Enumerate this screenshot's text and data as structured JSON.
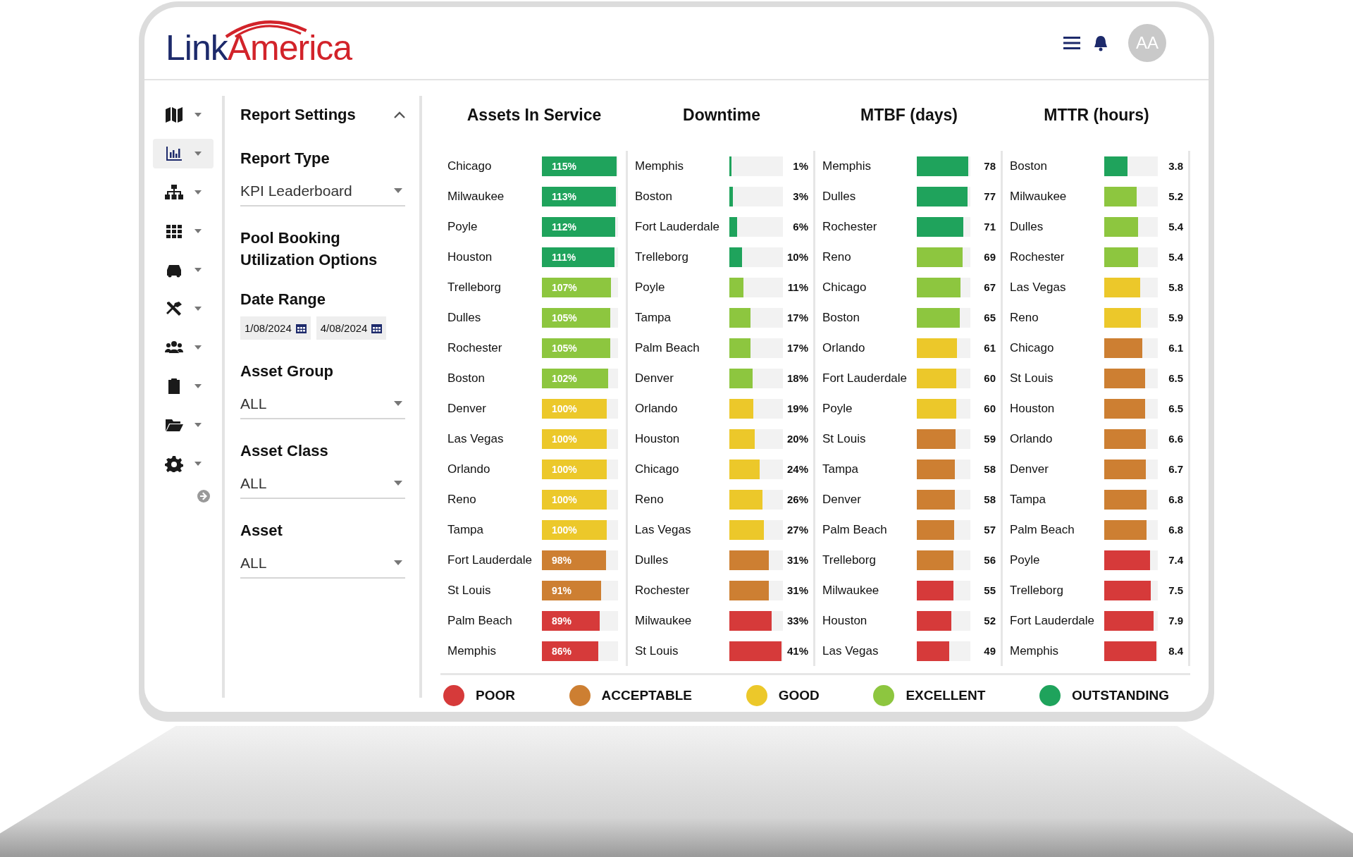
{
  "header": {
    "logo": {
      "part_1": "Link",
      "part_2": "America"
    },
    "avatar": "AA"
  },
  "sidebar": {
    "items": [
      {
        "selected": false
      },
      {
        "selected": true
      },
      {
        "selected": false
      },
      {
        "selected": false
      },
      {
        "selected": false
      },
      {
        "selected": false
      },
      {
        "selected": false
      },
      {
        "selected": false
      },
      {
        "selected": false
      },
      {
        "selected": false
      }
    ]
  },
  "settings": {
    "title": "Report Settings",
    "expanded": true,
    "fields": [
      {
        "kind": "select",
        "label": "Report Type",
        "value": "KPI Leaderboard"
      },
      {
        "kind": "heading",
        "label": "Pool Booking Utilization Options"
      },
      {
        "kind": "date_range",
        "label": "Date Range",
        "values": [
          "1/08/2024",
          "4/08/2024"
        ]
      },
      {
        "kind": "select",
        "label": "Asset Group",
        "value": "ALL"
      },
      {
        "kind": "select",
        "label": "Asset Class",
        "value": "ALL"
      },
      {
        "kind": "select",
        "label": "Asset",
        "value": "ALL"
      }
    ]
  },
  "metrics": [
    {
      "title": "Assets In Service",
      "kind": "inbar",
      "rows": [
        {
          "name": "Chicago",
          "value": "115%",
          "level": 0.98,
          "color": "#1fa35c"
        },
        {
          "name": "Milwaukee",
          "value": "113%",
          "level": 0.97,
          "color": "#1fa35c"
        },
        {
          "name": "Poyle",
          "value": "112%",
          "level": 0.96,
          "color": "#1fa35c"
        },
        {
          "name": "Houston",
          "value": "111%",
          "level": 0.95,
          "color": "#1fa35c"
        },
        {
          "name": "Trelleborg",
          "value": "107%",
          "level": 0.91,
          "color": "#8dc63f"
        },
        {
          "name": "Dulles",
          "value": "105%",
          "level": 0.9,
          "color": "#8dc63f"
        },
        {
          "name": "Rochester",
          "value": "105%",
          "level": 0.9,
          "color": "#8dc63f"
        },
        {
          "name": "Boston",
          "value": "102%",
          "level": 0.87,
          "color": "#8dc63f"
        },
        {
          "name": "Denver",
          "value": "100%",
          "level": 0.85,
          "color": "#ecc82a"
        },
        {
          "name": "Las Vegas",
          "value": "100%",
          "level": 0.85,
          "color": "#ecc82a"
        },
        {
          "name": "Orlando",
          "value": "100%",
          "level": 0.85,
          "color": "#ecc82a"
        },
        {
          "name": "Reno",
          "value": "100%",
          "level": 0.85,
          "color": "#ecc82a"
        },
        {
          "name": "Tampa",
          "value": "100%",
          "level": 0.85,
          "color": "#ecc82a"
        },
        {
          "name": "Fort Lauderdale",
          "value": "98%",
          "level": 0.84,
          "color": "#cd7f32"
        },
        {
          "name": "St Louis",
          "value": "91%",
          "level": 0.78,
          "color": "#cd7f32"
        },
        {
          "name": "Palm Beach",
          "value": "89%",
          "level": 0.76,
          "color": "#d63a3a"
        },
        {
          "name": "Memphis",
          "value": "86%",
          "level": 0.74,
          "color": "#d63a3a"
        }
      ]
    },
    {
      "title": "Downtime",
      "kind": "outbar",
      "rows": [
        {
          "name": "Memphis",
          "value": "1%",
          "level": 0.04,
          "color": "#1fa35c"
        },
        {
          "name": "Boston",
          "value": "3%",
          "level": 0.07,
          "color": "#1fa35c"
        },
        {
          "name": "Fort Lauderdale",
          "value": "6%",
          "level": 0.14,
          "color": "#1fa35c"
        },
        {
          "name": "Trelleborg",
          "value": "10%",
          "level": 0.24,
          "color": "#1fa35c"
        },
        {
          "name": "Poyle",
          "value": "11%",
          "level": 0.26,
          "color": "#8dc63f"
        },
        {
          "name": "Tampa",
          "value": "17%",
          "level": 0.4,
          "color": "#8dc63f"
        },
        {
          "name": "Palm Beach",
          "value": "17%",
          "level": 0.4,
          "color": "#8dc63f"
        },
        {
          "name": "Denver",
          "value": "18%",
          "level": 0.43,
          "color": "#8dc63f"
        },
        {
          "name": "Orlando",
          "value": "19%",
          "level": 0.45,
          "color": "#ecc82a"
        },
        {
          "name": "Houston",
          "value": "20%",
          "level": 0.48,
          "color": "#ecc82a"
        },
        {
          "name": "Chicago",
          "value": "24%",
          "level": 0.57,
          "color": "#ecc82a"
        },
        {
          "name": "Reno",
          "value": "26%",
          "level": 0.62,
          "color": "#ecc82a"
        },
        {
          "name": "Las Vegas",
          "value": "27%",
          "level": 0.64,
          "color": "#ecc82a"
        },
        {
          "name": "Dulles",
          "value": "31%",
          "level": 0.74,
          "color": "#cd7f32"
        },
        {
          "name": "Rochester",
          "value": "31%",
          "level": 0.74,
          "color": "#cd7f32"
        },
        {
          "name": "Milwaukee",
          "value": "33%",
          "level": 0.79,
          "color": "#d63a3a"
        },
        {
          "name": "St Louis",
          "value": "41%",
          "level": 0.98,
          "color": "#d63a3a"
        }
      ]
    },
    {
      "title": "MTBF (days)",
      "kind": "outbar",
      "rows": [
        {
          "name": "Memphis",
          "value": "78",
          "level": 0.96,
          "color": "#1fa35c"
        },
        {
          "name": "Dulles",
          "value": "77",
          "level": 0.95,
          "color": "#1fa35c"
        },
        {
          "name": "Rochester",
          "value": "71",
          "level": 0.87,
          "color": "#1fa35c"
        },
        {
          "name": "Reno",
          "value": "69",
          "level": 0.85,
          "color": "#8dc63f"
        },
        {
          "name": "Chicago",
          "value": "67",
          "level": 0.82,
          "color": "#8dc63f"
        },
        {
          "name": "Boston",
          "value": "65",
          "level": 0.8,
          "color": "#8dc63f"
        },
        {
          "name": "Orlando",
          "value": "61",
          "level": 0.75,
          "color": "#ecc82a"
        },
        {
          "name": "Fort Lauderdale",
          "value": "60",
          "level": 0.74,
          "color": "#ecc82a"
        },
        {
          "name": "Poyle",
          "value": "60",
          "level": 0.74,
          "color": "#ecc82a"
        },
        {
          "name": "St Louis",
          "value": "59",
          "level": 0.73,
          "color": "#cd7f32"
        },
        {
          "name": "Tampa",
          "value": "58",
          "level": 0.71,
          "color": "#cd7f32"
        },
        {
          "name": "Denver",
          "value": "58",
          "level": 0.71,
          "color": "#cd7f32"
        },
        {
          "name": "Palm Beach",
          "value": "57",
          "level": 0.7,
          "color": "#cd7f32"
        },
        {
          "name": "Trelleborg",
          "value": "56",
          "level": 0.69,
          "color": "#cd7f32"
        },
        {
          "name": "Milwaukee",
          "value": "55",
          "level": 0.68,
          "color": "#d63a3a"
        },
        {
          "name": "Houston",
          "value": "52",
          "level": 0.64,
          "color": "#d63a3a"
        },
        {
          "name": "Las Vegas",
          "value": "49",
          "level": 0.6,
          "color": "#d63a3a"
        }
      ]
    },
    {
      "title": "MTTR (hours)",
      "kind": "outbar",
      "rows": [
        {
          "name": "Boston",
          "value": "3.8",
          "level": 0.44,
          "color": "#1fa35c"
        },
        {
          "name": "Milwaukee",
          "value": "5.2",
          "level": 0.6,
          "color": "#8dc63f"
        },
        {
          "name": "Dulles",
          "value": "5.4",
          "level": 0.63,
          "color": "#8dc63f"
        },
        {
          "name": "Rochester",
          "value": "5.4",
          "level": 0.63,
          "color": "#8dc63f"
        },
        {
          "name": "Las Vegas",
          "value": "5.8",
          "level": 0.67,
          "color": "#ecc82a"
        },
        {
          "name": "Reno",
          "value": "5.9",
          "level": 0.69,
          "color": "#ecc82a"
        },
        {
          "name": "Chicago",
          "value": "6.1",
          "level": 0.71,
          "color": "#cd7f32"
        },
        {
          "name": "St Louis",
          "value": "6.5",
          "level": 0.76,
          "color": "#cd7f32"
        },
        {
          "name": "Houston",
          "value": "6.5",
          "level": 0.76,
          "color": "#cd7f32"
        },
        {
          "name": "Orlando",
          "value": "6.6",
          "level": 0.77,
          "color": "#cd7f32"
        },
        {
          "name": "Denver",
          "value": "6.7",
          "level": 0.78,
          "color": "#cd7f32"
        },
        {
          "name": "Tampa",
          "value": "6.8",
          "level": 0.79,
          "color": "#cd7f32"
        },
        {
          "name": "Palm Beach",
          "value": "6.8",
          "level": 0.79,
          "color": "#cd7f32"
        },
        {
          "name": "Poyle",
          "value": "7.4",
          "level": 0.86,
          "color": "#d63a3a"
        },
        {
          "name": "Trelleborg",
          "value": "7.5",
          "level": 0.87,
          "color": "#d63a3a"
        },
        {
          "name": "Fort Lauderdale",
          "value": "7.9",
          "level": 0.92,
          "color": "#d63a3a"
        },
        {
          "name": "Memphis",
          "value": "8.4",
          "level": 0.98,
          "color": "#d63a3a"
        }
      ]
    }
  ],
  "legend": [
    {
      "label": "POOR",
      "color": "#d63a3a"
    },
    {
      "label": "ACCEPTABLE",
      "color": "#cd7f32"
    },
    {
      "label": "GOOD",
      "color": "#ecc82a"
    },
    {
      "label": "EXCELLENT",
      "color": "#8dc63f"
    },
    {
      "label": "OUTSTANDING",
      "color": "#1fa35c"
    }
  ]
}
